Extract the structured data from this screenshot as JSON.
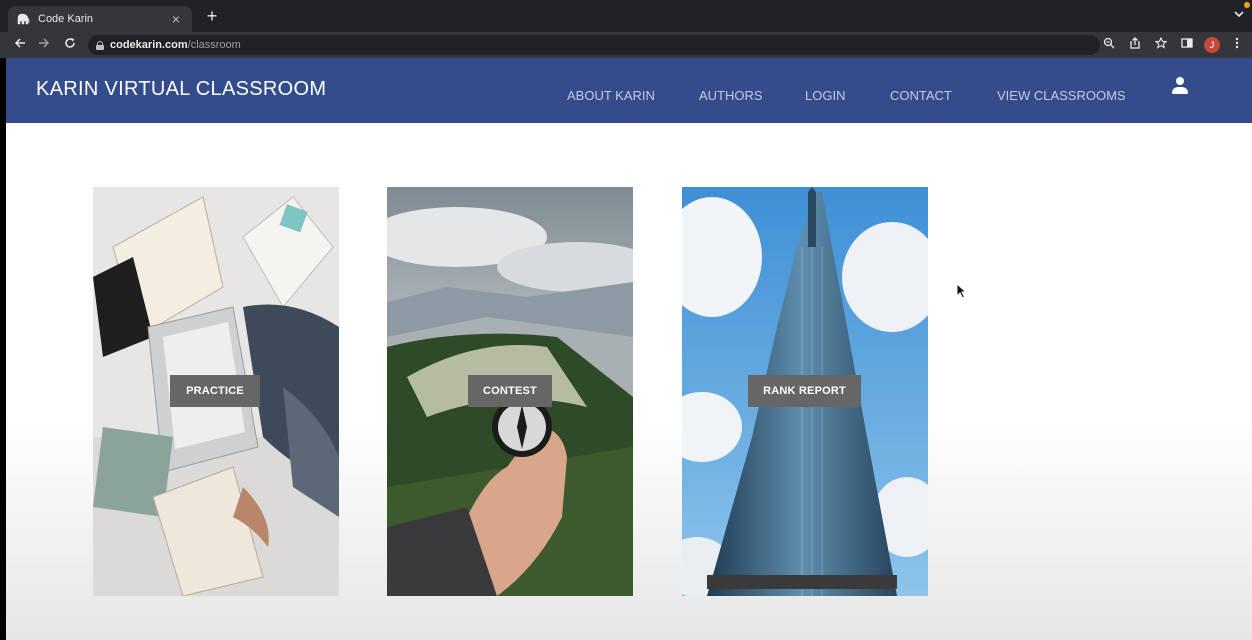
{
  "browser": {
    "tab_title": "Code Karin",
    "tab_close": "×",
    "new_tab": "+",
    "url_host": "codekarin.com",
    "url_path": "/classroom",
    "profile_initial": "J"
  },
  "site": {
    "brand": "KARIN VIRTUAL CLASSROOM",
    "nav": {
      "about": "ABOUT KARIN",
      "authors": "AUTHORS",
      "login": "LOGIN",
      "contact": "CONTACT",
      "classrooms": "VIEW CLASSROOMS"
    }
  },
  "cards": {
    "practice": "PRACTICE",
    "contest": "CONTEST",
    "rank_report": "RANK REPORT"
  },
  "colors": {
    "nav_bg": "#344c8c",
    "button_bg": "#666666"
  }
}
